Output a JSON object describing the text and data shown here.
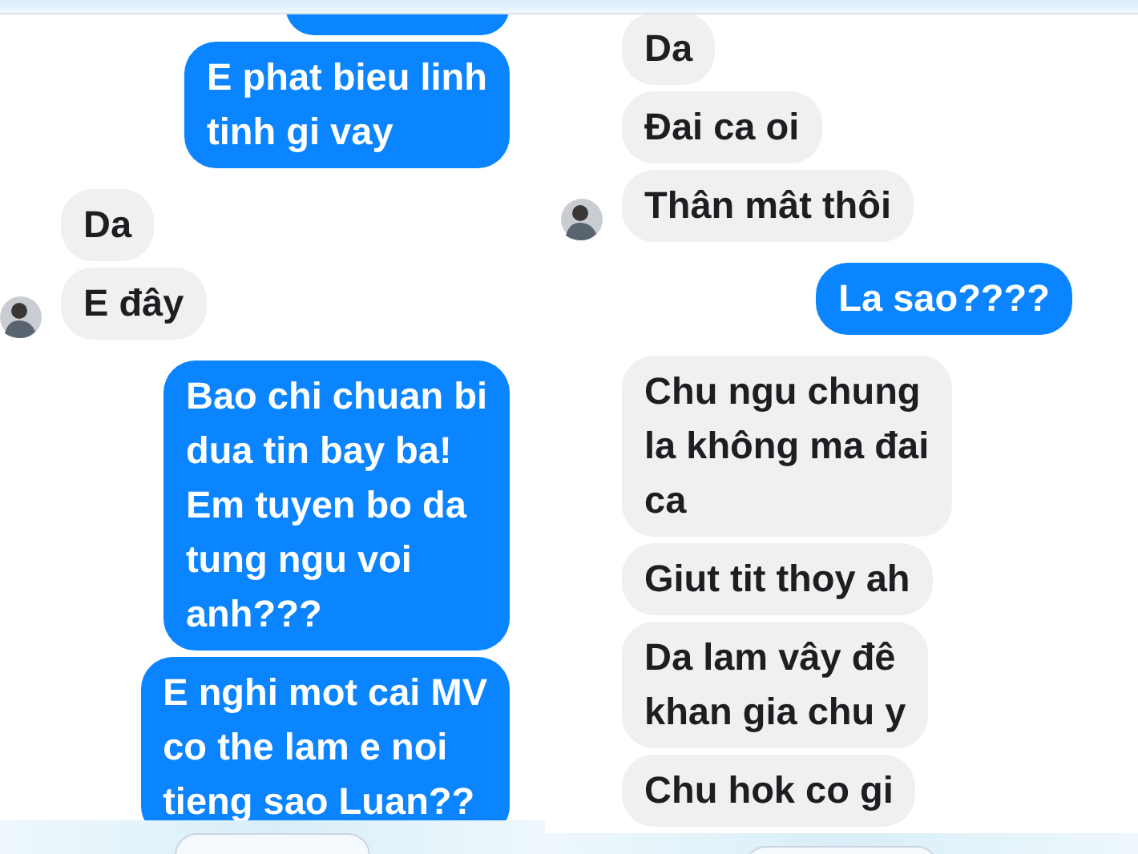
{
  "panels": [
    {
      "messages": [
        {
          "outgoing": true,
          "kind": "clipped"
        },
        {
          "outgoing": true,
          "kind": "text",
          "lines": [
            "E phat bieu linh",
            "tinh gi vay"
          ]
        },
        {
          "outgoing": false,
          "kind": "text",
          "lines": [
            "Da"
          ]
        },
        {
          "outgoing": false,
          "kind": "text",
          "lines": [
            "E đây"
          ]
        },
        {
          "outgoing": true,
          "kind": "text",
          "lines": [
            "Bao chi chuan bi",
            "dua tin bay ba!",
            "Em tuyen bo da",
            "tung ngu voi",
            "anh???"
          ]
        },
        {
          "outgoing": true,
          "kind": "text",
          "lines": [
            "E nghi mot cai MV",
            "co the lam e noi",
            "tieng sao Luan??"
          ]
        }
      ]
    },
    {
      "messages": [
        {
          "outgoing": false,
          "kind": "text",
          "lines": [
            "Da"
          ]
        },
        {
          "outgoing": false,
          "kind": "text",
          "lines": [
            "Đai ca oi"
          ]
        },
        {
          "outgoing": false,
          "kind": "text",
          "lines": [
            "Thân mât thôi"
          ]
        },
        {
          "outgoing": true,
          "kind": "text",
          "lines": [
            "La sao????"
          ]
        },
        {
          "outgoing": false,
          "kind": "text",
          "lines": [
            "Chu ngu chung",
            "la không ma đai",
            "ca"
          ]
        },
        {
          "outgoing": false,
          "kind": "text",
          "lines": [
            "Giut tit thoy ah"
          ]
        },
        {
          "outgoing": false,
          "kind": "text",
          "lines": [
            "Da lam vây đê",
            "khan gia chu y"
          ]
        },
        {
          "outgoing": false,
          "kind": "text",
          "lines": [
            "Chu hok co gi"
          ]
        }
      ]
    }
  ]
}
